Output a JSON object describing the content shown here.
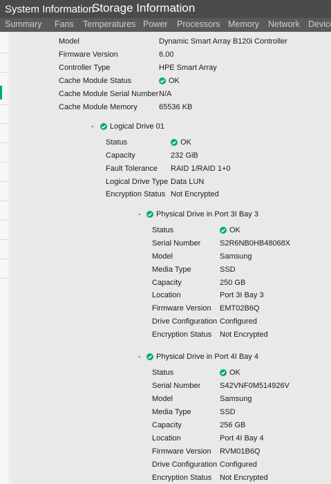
{
  "header": {
    "title": "System Information -",
    "subtitle": "Storage Information"
  },
  "tabs": [
    "Summary",
    "Fans",
    "Temperatures",
    "Power",
    "Processors",
    "Memory",
    "Network",
    "Device"
  ],
  "controller": {
    "model_label": "Model",
    "model_value": "Dynamic Smart Array B120i Controller",
    "firmware_label": "Firmware Version",
    "firmware_value": "6.00",
    "type_label": "Controller Type",
    "type_value": "HPE Smart Array",
    "cache_status_label": "Cache Module Status",
    "cache_status_value": "OK",
    "cache_serial_label": "Cache Module Serial Number",
    "cache_serial_value": "N/A",
    "cache_memory_label": "Cache Module Memory",
    "cache_memory_value": "65536 KB"
  },
  "logical_drive": {
    "collapse_symbol": "-",
    "title": "Logical Drive 01",
    "status_label": "Status",
    "status_value": "OK",
    "capacity_label": "Capacity",
    "capacity_value": "232 GiB",
    "fault_label": "Fault Tolerance",
    "fault_value": "RAID 1/RAID 1+0",
    "type_label": "Logical Drive Type",
    "type_value": "Data LUN",
    "encryption_label": "Encryption Status",
    "encryption_value": "Not Encrypted"
  },
  "physical_drives": [
    {
      "collapse_symbol": "-",
      "title": "Physical Drive in Port 3I Bay 3",
      "status_label": "Status",
      "status_value": "OK",
      "serial_label": "Serial Number",
      "serial_value": "S2R6NB0HB48068X",
      "model_label": "Model",
      "model_value": "Samsung",
      "media_label": "Media Type",
      "media_value": "SSD",
      "capacity_label": "Capacity",
      "capacity_value": "250 GB",
      "location_label": "Location",
      "location_value": "Port 3I Bay 3",
      "firmware_label": "Firmware Version",
      "firmware_value": "EMT02B6Q",
      "config_label": "Drive Configuration",
      "config_value": "Configured",
      "encryption_label": "Encryption Status",
      "encryption_value": "Not Encrypted"
    },
    {
      "collapse_symbol": "-",
      "title": "Physical Drive in Port 4I Bay 4",
      "status_label": "Status",
      "status_value": "OK",
      "serial_label": "Serial Number",
      "serial_value": "S42VNF0M514926V",
      "model_label": "Model",
      "model_value": "Samsung",
      "media_label": "Media Type",
      "media_value": "SSD",
      "capacity_label": "Capacity",
      "capacity_value": "256 GB",
      "location_label": "Location",
      "location_value": "Port 4I Bay 4",
      "firmware_label": "Firmware Version",
      "firmware_value": "RVM01B6Q",
      "config_label": "Drive Configuration",
      "config_value": "Configured",
      "encryption_label": "Encryption Status",
      "encryption_value": "Not Encrypted"
    }
  ],
  "colors": {
    "ok_green": "#01a982",
    "header_bg": "#4b4b4b",
    "tabs_bg": "#5a5a5a",
    "panel_bg": "#e9e9e9"
  }
}
